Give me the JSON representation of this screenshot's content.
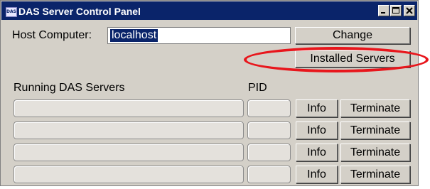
{
  "window": {
    "icon_label": "DAS",
    "title": "DAS Server Control Panel"
  },
  "host": {
    "label": "Host Computer:",
    "value": "localhost",
    "change_label": "Change",
    "installed_label": "Installed Servers"
  },
  "running": {
    "header": "Running DAS Servers",
    "pid_header": "PID",
    "rows": [
      {
        "server": "",
        "pid": "",
        "info_label": "Info",
        "terminate_label": "Terminate"
      },
      {
        "server": "",
        "pid": "",
        "info_label": "Info",
        "terminate_label": "Terminate"
      },
      {
        "server": "",
        "pid": "",
        "info_label": "Info",
        "terminate_label": "Terminate"
      },
      {
        "server": "",
        "pid": "",
        "info_label": "Info",
        "terminate_label": "Terminate"
      }
    ]
  },
  "annotation": {
    "color": "#e8161c",
    "target": "Installed Servers"
  },
  "colors": {
    "titlebar": "#0a246a",
    "window_bg": "#d4d0c8",
    "selection": "#0a246a"
  }
}
